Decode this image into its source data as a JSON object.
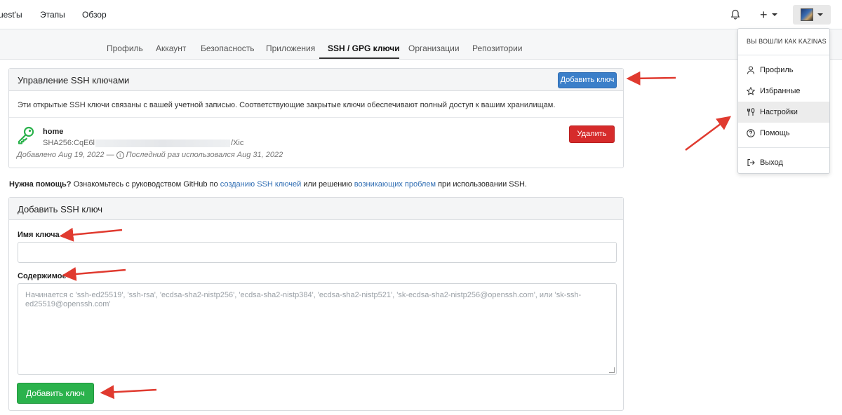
{
  "topnav": {
    "links": [
      "uest'ы",
      "Этапы",
      "Обзор"
    ],
    "plus_label": "+"
  },
  "tabs": [
    "Профиль",
    "Аккаунт",
    "Безопасность",
    "Приложения",
    "SSH / GPG ключи",
    "Организации",
    "Репозитории"
  ],
  "active_tab_index": 4,
  "ssh_panel": {
    "title": "Управление SSH ключами",
    "add_button": "Добавить ключ",
    "description": "Эти открытые SSH ключи связаны с вашей учетной записью. Соответствующие закрытые ключи обеспечивают полный доступ к вашим хранилищам.",
    "key": {
      "name": "home",
      "fingerprint_start": "SHA256:CqE6l",
      "fingerprint_end": "/Xic",
      "added": "Добавлено Aug 19, 2022 —",
      "last_used": "Последний раз использовался Aug 31, 2022",
      "delete_button": "Удалить"
    }
  },
  "help": {
    "bold": "Нужна помощь?",
    "text1": " Ознакомьтесь с руководством GitHub по ",
    "link1": "созданию SSH ключей",
    "text2": " или решению ",
    "link2": "возникающих проблем",
    "text3": " при использовании SSH."
  },
  "add_panel": {
    "title": "Добавить SSH ключ",
    "name_label": "Имя ключа",
    "name_value": "",
    "content_label": "Содержимое",
    "content_placeholder": "Начинается с 'ssh-ed25519', 'ssh-rsa', 'ecdsa-sha2-nistp256', 'ecdsa-sha2-nistp384', 'ecdsa-sha2-nistp521', 'sk-ecdsa-sha2-nistp256@openssh.com', или 'sk-ssh-ed25519@openssh.com'",
    "submit_button": "Добавить ключ"
  },
  "dropdown": {
    "header": "ВЫ ВОШЛИ КАК KAZINAS",
    "items": [
      "Профиль",
      "Избранные",
      "Настройки",
      "Помощь"
    ],
    "logout": "Выход",
    "active_item": "Настройки"
  },
  "colors": {
    "primary": "#3b7fc9",
    "danger": "#d62b2b",
    "success": "#2bb24c",
    "key_icon": "#2bb24c",
    "annotation_arrow": "#e03a2f"
  }
}
